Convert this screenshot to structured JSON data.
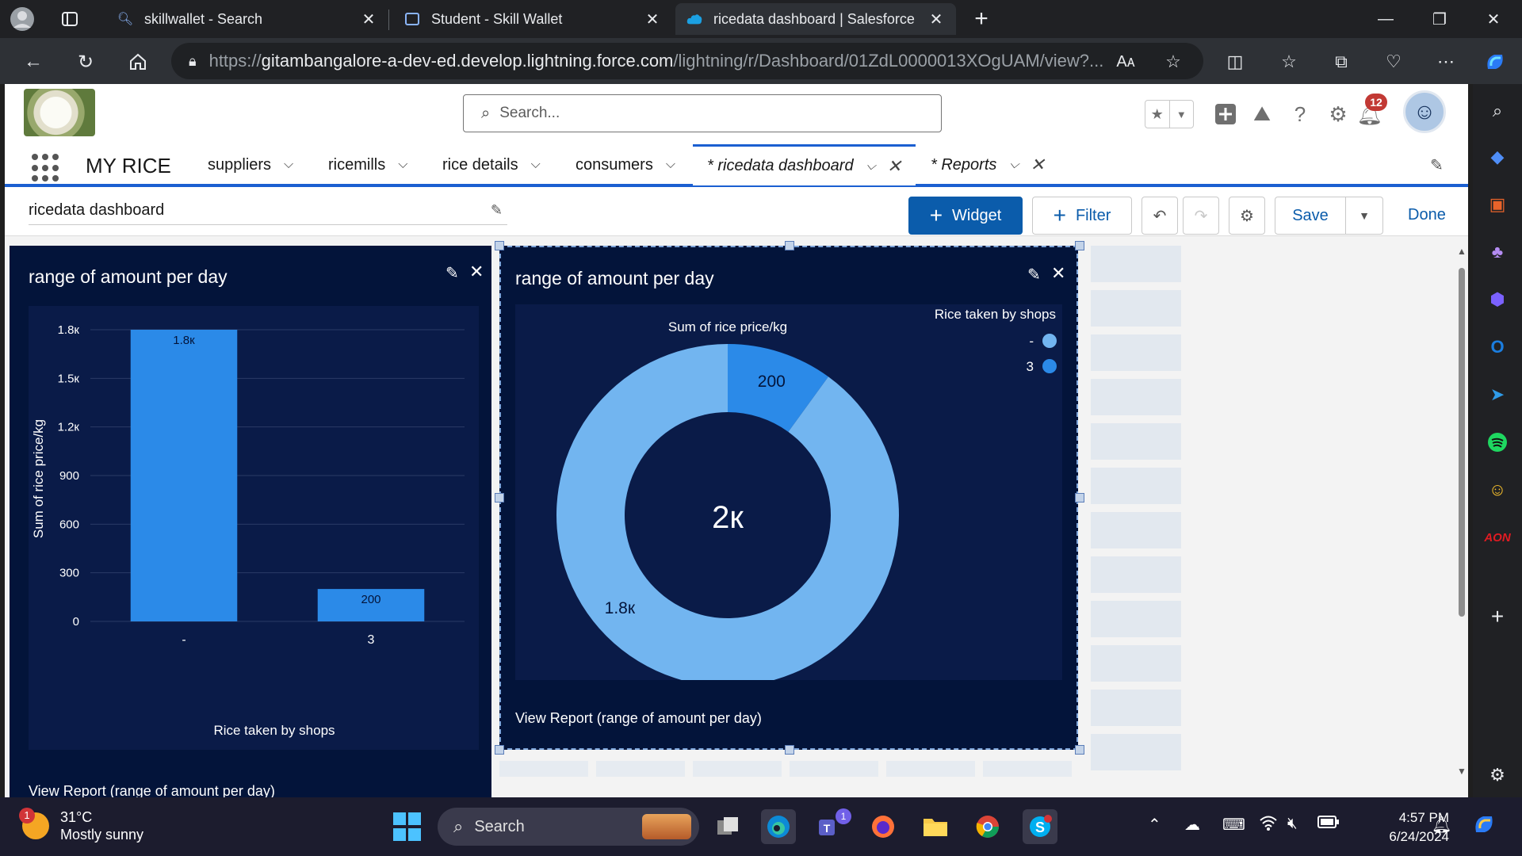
{
  "browser": {
    "tabs": [
      {
        "title": "skillwallet - Search",
        "icon": "search-icon"
      },
      {
        "title": "Student - Skill Wallet",
        "icon": "page-icon"
      },
      {
        "title": "ricedata dashboard | Salesforce",
        "icon": "salesforce-cloud-icon"
      }
    ],
    "url_prefix": "https://",
    "url_host": "gitambangalore-a-dev-ed.develop.lightning.force.com",
    "url_path": "/lightning/r/Dashboard/01ZdL0000013XOgUAM/view?..."
  },
  "sf": {
    "search_placeholder": "Search...",
    "notification_count": "12",
    "app_name": "MY RICE",
    "nav_items": [
      {
        "label": "suppliers"
      },
      {
        "label": "ricemills"
      },
      {
        "label": "rice details"
      },
      {
        "label": "consumers"
      },
      {
        "label": "* ricedata dashboard"
      },
      {
        "label": "* Reports"
      }
    ],
    "dashboard_name": "ricedata dashboard",
    "toolbar": {
      "widget_label": "Widget",
      "filter_label": "Filter",
      "save_label": "Save",
      "done_label": "Done"
    }
  },
  "widgets": [
    {
      "title": "range of amount per day",
      "footer": "View Report (range of amount per day)"
    },
    {
      "title": "range of amount per day",
      "footer": "View Report (range of amount per day)"
    }
  ],
  "chart_data": [
    {
      "type": "bar",
      "title": "",
      "xlabel": "Rice taken by shops",
      "ylabel": "Sum of rice price/kg",
      "categories": [
        "-",
        "3"
      ],
      "values": [
        1800,
        200
      ],
      "data_labels": [
        "1.8к",
        "200"
      ],
      "yticks": [
        0,
        300,
        600,
        900,
        1200,
        1500,
        1800
      ],
      "ytick_labels": [
        "0",
        "300",
        "600",
        "900",
        "1.2к",
        "1.5к",
        "1.8к"
      ],
      "ylim": [
        0,
        1800
      ],
      "bar_color": "#2b8ae8",
      "grid": true
    },
    {
      "type": "pie",
      "subtitle": "Sum of rice price/kg",
      "legend_title": "Rice taken by shops",
      "legend_placement": "top-right",
      "center_label": "2к",
      "slices": [
        {
          "label": "-",
          "value": 1800,
          "display": "1.8к",
          "color": "#72b5f0"
        },
        {
          "label": "3",
          "value": 200,
          "display": "200",
          "color": "#2b8ae8"
        }
      ]
    }
  ],
  "taskbar": {
    "weather_temp": "31°C",
    "weather_cond": "Mostly sunny",
    "weather_badge": "1",
    "search_label": "Search",
    "teams_badge": "1",
    "time": "4:57 PM",
    "date": "6/24/2024"
  }
}
